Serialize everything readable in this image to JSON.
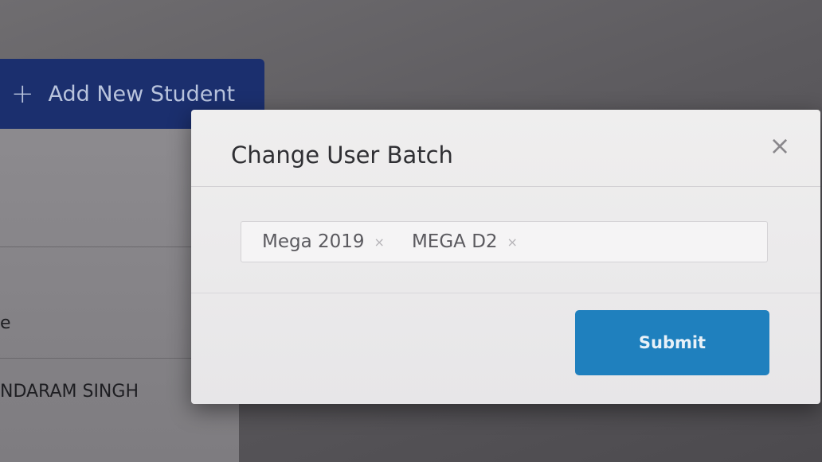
{
  "page": {
    "add_button_label": "Add New Student",
    "partial_column_label": "e",
    "partial_student_name": "NDARAM SINGH"
  },
  "modal": {
    "title": "Change User Batch",
    "close_symbol": "×",
    "selected_batches": [
      {
        "label": "Mega 2019",
        "remove": "×"
      },
      {
        "label": "MEGA D2",
        "remove": "×"
      }
    ],
    "submit_label": "Submit"
  },
  "colors": {
    "add_button_bg": "#1b2f6e",
    "submit_bg": "#1f80be",
    "modal_bg": "#efeeee"
  }
}
